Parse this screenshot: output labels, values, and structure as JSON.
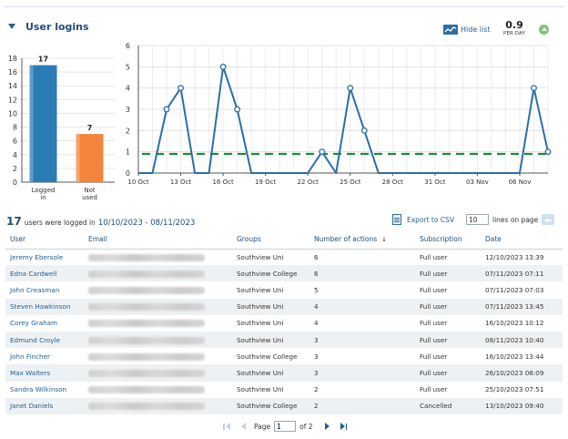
{
  "panel": {
    "title": "User logins",
    "hide_list_label": "Hide list",
    "per_day_value": "0.9",
    "per_day_unit": "PER DAY"
  },
  "bar_chart": {
    "type": "bar",
    "categories": [
      "Logged in",
      "Not used"
    ],
    "category_lines": [
      [
        "Logged",
        "in"
      ],
      [
        "Not",
        "used"
      ]
    ],
    "values": [
      17,
      7
    ],
    "value_labels": [
      "17",
      "7"
    ],
    "ylim": [
      0,
      18
    ],
    "yticks": [
      0,
      2,
      4,
      6,
      8,
      10,
      12,
      14,
      16,
      18
    ],
    "colors": [
      "#2b7bb5",
      "#f4843c"
    ]
  },
  "chart_data": {
    "type": "line",
    "x_dates": [
      "10 Oct",
      "11 Oct",
      "12 Oct",
      "13 Oct",
      "14 Oct",
      "15 Oct",
      "16 Oct",
      "17 Oct",
      "18 Oct",
      "19 Oct",
      "20 Oct",
      "21 Oct",
      "22 Oct",
      "23 Oct",
      "24 Oct",
      "25 Oct",
      "26 Oct",
      "27 Oct",
      "28 Oct",
      "29 Oct",
      "30 Oct",
      "31 Oct",
      "01 Nov",
      "02 Nov",
      "03 Nov",
      "04 Nov",
      "05 Nov",
      "06 Nov",
      "07 Nov",
      "08 Nov"
    ],
    "values": [
      0,
      0,
      3,
      4,
      0,
      0,
      5,
      3,
      0,
      0,
      0,
      0,
      0,
      1,
      0,
      4,
      2,
      0,
      0,
      0,
      0,
      0,
      0,
      0,
      0,
      0,
      0,
      0,
      4,
      1
    ],
    "markers": [
      false,
      false,
      true,
      true,
      false,
      false,
      true,
      true,
      false,
      false,
      false,
      false,
      false,
      true,
      false,
      true,
      true,
      false,
      false,
      false,
      false,
      false,
      false,
      false,
      false,
      false,
      false,
      false,
      true,
      true
    ],
    "average": 0.9,
    "tick_labels": [
      "10 Oct",
      "13 Oct",
      "16 Oct",
      "19 Oct",
      "22 Oct",
      "25 Oct",
      "28 Oct",
      "31 Oct",
      "03 Nov",
      "06 Nov"
    ],
    "ylim": [
      0,
      6
    ],
    "yticks": [
      0,
      1,
      2,
      3,
      4,
      5,
      6
    ],
    "colors": {
      "line": "#2b6ea8",
      "average": "#1f8a3a"
    }
  },
  "summary": {
    "count": "17",
    "text": "users were logged in",
    "range": "10/10/2023 - 08/11/2023"
  },
  "toolbar": {
    "export_label": "Export to CSV",
    "lines_value": "10",
    "lines_label": "lines on page"
  },
  "table": {
    "headers": [
      "User",
      "Email",
      "Groups",
      "Number of actions",
      "Subscription",
      "Date"
    ],
    "sort_indicator": "↓",
    "rows": [
      {
        "user": "Jeremy Ebersole",
        "group": "Southview Uni",
        "actions": "6",
        "subscription": "Full user",
        "date": "12/10/2023 13:39"
      },
      {
        "user": "Edna Cardwell",
        "group": "Southview College",
        "actions": "6",
        "subscription": "Full user",
        "date": "07/11/2023 07:11"
      },
      {
        "user": "John Creasman",
        "group": "Southview Uni",
        "actions": "5",
        "subscription": "Full user",
        "date": "07/11/2023 07:03"
      },
      {
        "user": "Steven Hawkinson",
        "group": "Southview Uni",
        "actions": "4",
        "subscription": "Full user",
        "date": "07/11/2023 13:45"
      },
      {
        "user": "Corey Graham",
        "group": "Southview Uni",
        "actions": "4",
        "subscription": "Full user",
        "date": "16/10/2023 10:12"
      },
      {
        "user": "Edmund Croyle",
        "group": "Southview Uni",
        "actions": "3",
        "subscription": "Full user",
        "date": "08/11/2023 10:40"
      },
      {
        "user": "John Fincher",
        "group": "Southview College",
        "actions": "3",
        "subscription": "Full user",
        "date": "16/10/2023 13:44"
      },
      {
        "user": "Max Walters",
        "group": "Southview Uni",
        "actions": "3",
        "subscription": "Full user",
        "date": "26/10/2023 08:09"
      },
      {
        "user": "Sandra Wilkinson",
        "group": "Southview Uni",
        "actions": "2",
        "subscription": "Full user",
        "date": "25/10/2023 07:51"
      },
      {
        "user": "Janet Daniels",
        "group": "Southview College",
        "actions": "2",
        "subscription": "Cancelled",
        "date": "13/10/2023 09:40"
      }
    ]
  },
  "pager": {
    "page_label": "Page",
    "current_page": "1",
    "of_label": "of 2"
  }
}
